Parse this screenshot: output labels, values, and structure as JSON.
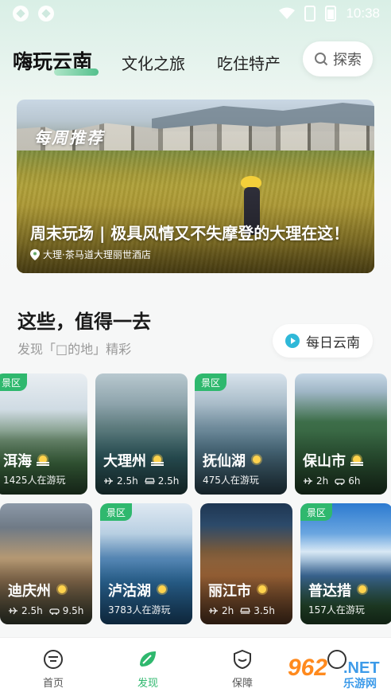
{
  "status_bar": {
    "time": "10:38"
  },
  "nav": {
    "tabs": [
      {
        "label": "嗨玩云南",
        "active": true
      },
      {
        "label": "文化之旅",
        "active": false
      },
      {
        "label": "吃住特产",
        "active": false
      }
    ],
    "search_label": "探索"
  },
  "banner": {
    "tag": "每周推荐",
    "title": "周末玩场 | 极具风情又不失摩登的大理在这！",
    "location": "大理·茶马道大理丽世酒店"
  },
  "section": {
    "title": "这些，值得一去",
    "subtitle": "发现「□的地」精彩",
    "daily_button": "每日云南"
  },
  "cards": [
    {
      "badge": "景区",
      "name": "洱海",
      "weather": "haze",
      "sub": "1425人在游玩"
    },
    {
      "badge": "",
      "name": "大理州",
      "weather": "haze",
      "sub_flight": "2.5h",
      "sub_train": "2.5h"
    },
    {
      "badge": "景区",
      "name": "抚仙湖",
      "weather": "sun",
      "sub": "475人在游玩"
    },
    {
      "badge": "",
      "name": "保山市",
      "weather": "haze",
      "sub_flight": "2h",
      "sub_car": "6h"
    },
    {
      "badge": "",
      "name": "迪庆州",
      "weather": "sun",
      "sub_flight": "2.5h",
      "sub_car": "9.5h"
    },
    {
      "badge": "景区",
      "name": "泸沽湖",
      "weather": "sun",
      "sub": "3783人在游玩"
    },
    {
      "badge": "",
      "name": "丽江市",
      "weather": "sun",
      "sub_flight": "2h",
      "sub_train": "3.5h"
    },
    {
      "badge": "景区",
      "name": "普达措",
      "weather": "sun",
      "sub": "157人在游玩"
    }
  ],
  "tabbar": [
    {
      "label": "首页",
      "active": false
    },
    {
      "label": "发现",
      "active": true
    },
    {
      "label": "保障",
      "active": false
    },
    {
      "label": "",
      "active": false
    }
  ],
  "watermark": {
    "num": "962",
    "net": ".NET",
    "cn": "乐游网"
  },
  "colors": {
    "accent": "#2fb86e",
    "badge": "#2fb86e",
    "daily_play": "#2fb8d8"
  }
}
